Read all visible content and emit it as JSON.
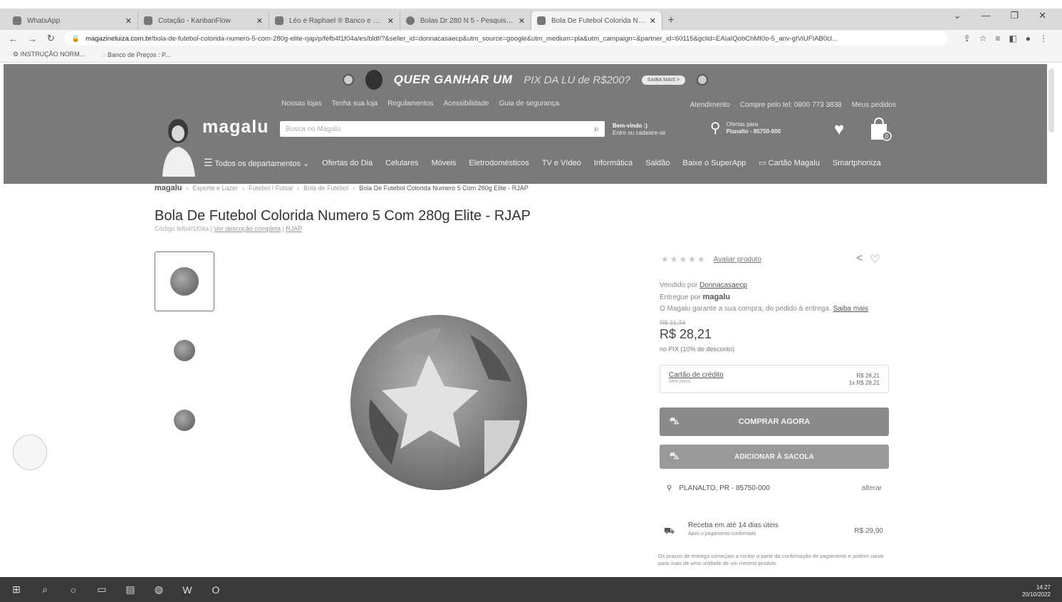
{
  "browser": {
    "tabs": [
      {
        "label": "WhatsApp",
        "active": false
      },
      {
        "label": "Cotação - KanbanFlow",
        "active": false
      },
      {
        "label": "Léo e Raphael ® Banco e Com",
        "active": false
      },
      {
        "label": "Bolas Dr 280 N 5 - Pesquisa Goo",
        "active": false
      },
      {
        "label": "Bola De Futebol Colorida Nume",
        "active": true
      }
    ],
    "new_tab": "+",
    "url_domain": "magazineluiza.com.br",
    "url_path": "/bola-de-futebol-colorida-numero-5-com-280g-elite-rjap/p/fefb4f1f04a/es/bldf/?&seller_id=donnacasaecp&utm_source=google&utm_medium=pla&utm_campaign=&partner_id=60115&gclid=EAIaIQobChMI0o-5_anv-gIViUFIAB0cl...",
    "bookmarks": [
      "INSTRUÇÃO NORM...",
      "Banco de Preços : P..."
    ]
  },
  "promo": {
    "text": "QUER GANHAR UM",
    "text2": "PIX DA LU de R$200?",
    "saiba_mais": "SAIBA MAIS >"
  },
  "header": {
    "top_links_left": [
      "Nossas lojas",
      "Tenha sua loja",
      "Regulamentos",
      "Acessibilidade",
      "Guia de segurança"
    ],
    "top_links_right": [
      "Atendimento",
      "Compre pelo tel: 0800 773 3838",
      "Meus pedidos"
    ],
    "logo": "magalu",
    "search_placeholder": "Busca no Magalu",
    "welcome_line1": "Bem-vindo :)",
    "welcome_line2": "Entre ou cadastre-se",
    "location_line1": "Ofertas para",
    "location_line2": "Planalto - 85750-000",
    "bag_count": "0",
    "nav": [
      "Todos os departamentos",
      "Ofertas do Dia",
      "Celulares",
      "Móveis",
      "Eletrodomésticos",
      "TV e Vídeo",
      "Informática",
      "Saldão",
      "Baixe o SuperApp",
      "Cartão Magalu",
      "Smartphoniza"
    ]
  },
  "breadcrumb": {
    "home": "magalu",
    "items": [
      "Esporte e Lazer",
      "Futebol / Futsal",
      "Bola de Futebol"
    ],
    "current": "Bola De Futebol Colorida Numero 5 Com 280g Elite - RJAP"
  },
  "product": {
    "title": "Bola De Futebol Colorida Numero 5 Com 280g Elite - RJAP",
    "code": "Código fefb4f1f04a",
    "full_desc": "Ver descrição completa",
    "brand": "RJAP",
    "rate_link": "Avaliar produto",
    "sold_by_label": "Vendido por",
    "sold_by": "Donnacasaecp",
    "delivered_by_label": "Entregue por",
    "delivered_by": "magalu",
    "guarantee": "O Magalu garante a sua compra, do pedido à entrega.",
    "saiba_mais": "Saiba mais",
    "old_price": "R$ 31,34",
    "price": "R$ 28,21",
    "pix_note": "no PIX (10% de desconto)",
    "credit_label": "Cartão de crédito",
    "credit_sub": "sem juros",
    "credit_total": "R$ 28,21",
    "credit_installment": "1x R$ 28,21",
    "buy_now": "COMPRAR AGORA",
    "add_to_bag": "ADICIONAR À SACOLA",
    "ship_to": "PLANALTO, PR - 85750-000",
    "ship_change": "alterar",
    "delivery_title": "Receba em até 14 dias úteis",
    "delivery_sub": "Após o pagamento confirmado",
    "delivery_price": "R$ 29,90",
    "delivery_note": "Os prazos de entrega começam a contar a partir da confirmação de pagamento e podem variar para mais de uma unidade de um mesmo produto"
  },
  "taskbar": {
    "time": "14:27",
    "date": "20/10/2022"
  },
  "colors": {
    "header_bg": "#7a7a7a",
    "button_bg": "#8a8a8a"
  }
}
